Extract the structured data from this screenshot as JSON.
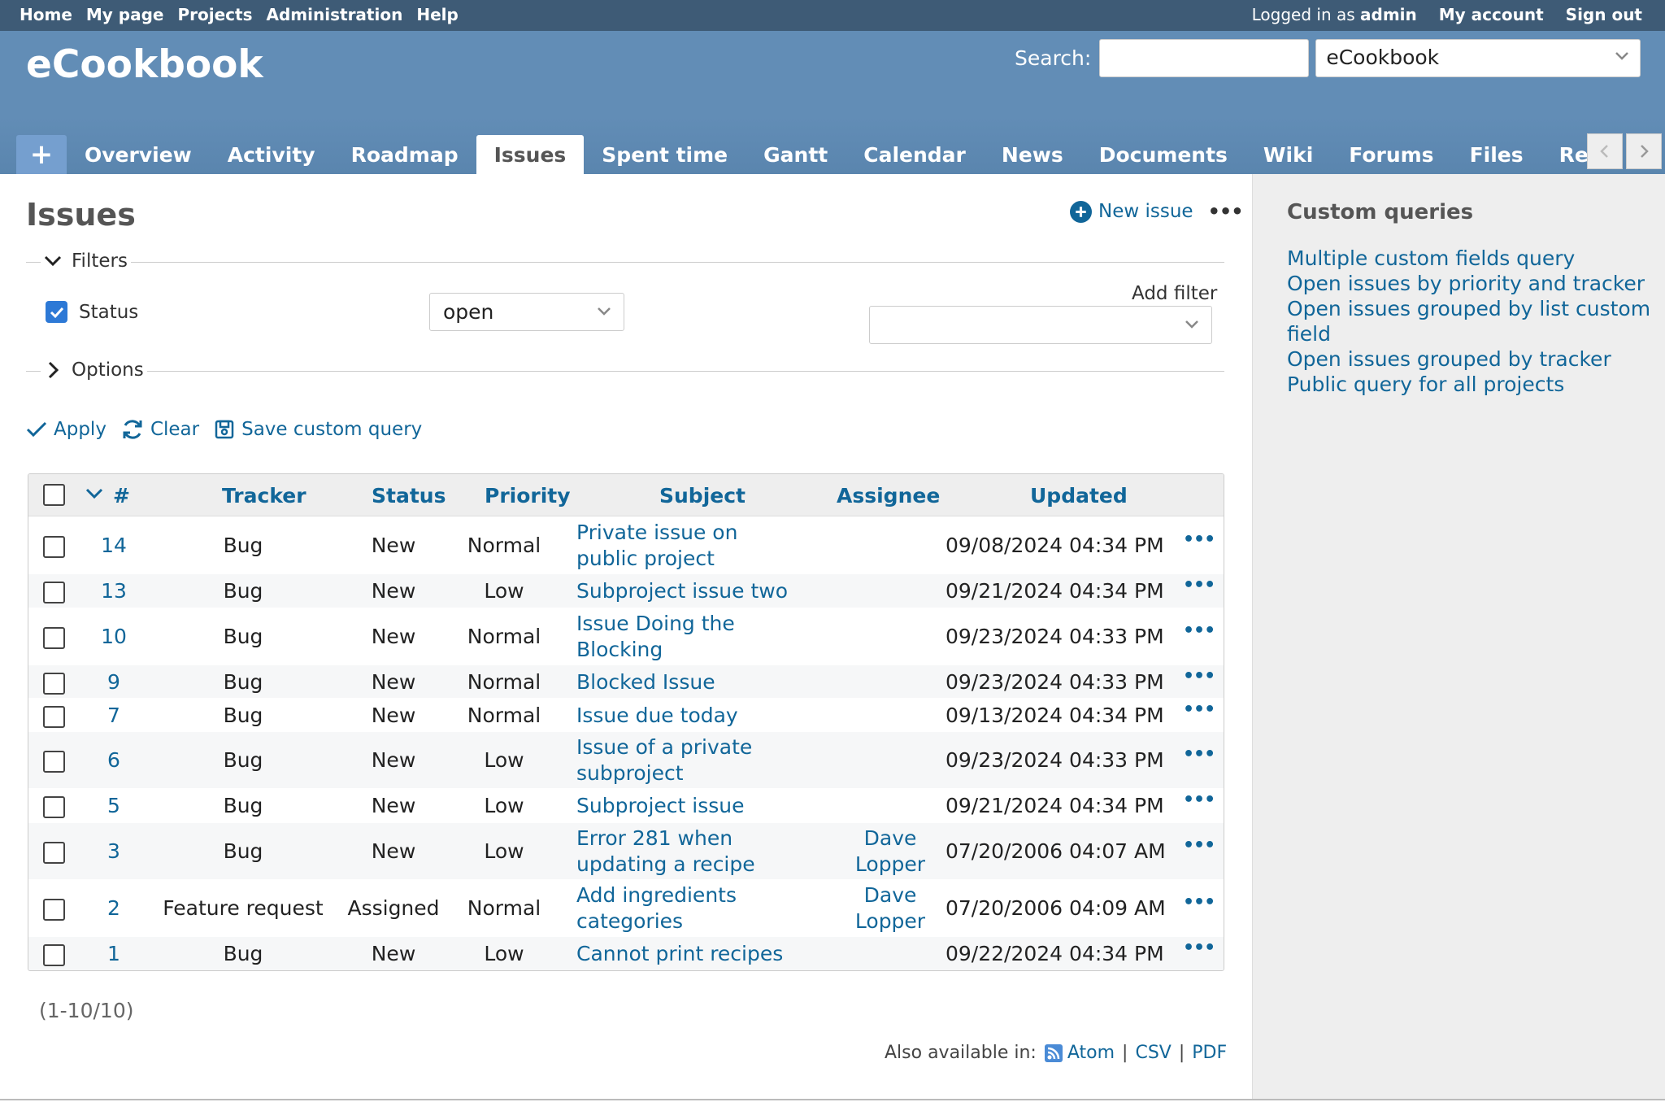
{
  "top_menu": {
    "left": [
      "Home",
      "My page",
      "Projects",
      "Administration",
      "Help"
    ],
    "logged_prefix": "Logged in as",
    "logged_user": "admin",
    "my_account": "My account",
    "sign_out": "Sign out"
  },
  "header": {
    "project_title": "eCookbook",
    "search_label": "Search:",
    "search_value": "",
    "project_select": "eCookbook"
  },
  "main_menu": {
    "plus": "+",
    "tabs": [
      "Overview",
      "Activity",
      "Roadmap",
      "Issues",
      "Spent time",
      "Gantt",
      "Calendar",
      "News",
      "Documents",
      "Wiki",
      "Forums",
      "Files",
      "Repository"
    ],
    "selected": "Issues"
  },
  "content": {
    "title": "Issues",
    "new_issue": "New issue",
    "more": "•••",
    "filters_legend": "Filters",
    "filter_status_label": "Status",
    "filter_status_operator": "open",
    "add_filter_label": "Add filter",
    "options_legend": "Options",
    "apply": "Apply",
    "clear": "Clear",
    "save_query": "Save custom query"
  },
  "table": {
    "headers": {
      "id": "#",
      "tracker": "Tracker",
      "status": "Status",
      "priority": "Priority",
      "subject": "Subject",
      "assignee": "Assignee",
      "updated": "Updated"
    },
    "rows": [
      {
        "id": "14",
        "tracker": "Bug",
        "status": "New",
        "priority": "Normal",
        "subject": "Private issue on public project",
        "subject_l1": "Private issue on",
        "subject_l2": "public project",
        "assignee_l1": "",
        "assignee_l2": "",
        "updated": "09/08/2024 04:34 PM"
      },
      {
        "id": "13",
        "tracker": "Bug",
        "status": "New",
        "priority": "Low",
        "subject_l1": "Subproject issue two",
        "subject_l2": "",
        "assignee_l1": "",
        "assignee_l2": "",
        "updated": "09/21/2024 04:34 PM"
      },
      {
        "id": "10",
        "tracker": "Bug",
        "status": "New",
        "priority": "Normal",
        "subject_l1": "Issue Doing the",
        "subject_l2": "Blocking",
        "assignee_l1": "",
        "assignee_l2": "",
        "updated": "09/23/2024 04:33 PM"
      },
      {
        "id": "9",
        "tracker": "Bug",
        "status": "New",
        "priority": "Normal",
        "subject_l1": "Blocked Issue",
        "subject_l2": "",
        "assignee_l1": "",
        "assignee_l2": "",
        "updated": "09/23/2024 04:33 PM"
      },
      {
        "id": "7",
        "tracker": "Bug",
        "status": "New",
        "priority": "Normal",
        "subject_l1": "Issue due today",
        "subject_l2": "",
        "assignee_l1": "",
        "assignee_l2": "",
        "updated": "09/13/2024 04:34 PM"
      },
      {
        "id": "6",
        "tracker": "Bug",
        "status": "New",
        "priority": "Low",
        "subject_l1": "Issue of a private",
        "subject_l2": "subproject",
        "assignee_l1": "",
        "assignee_l2": "",
        "updated": "09/23/2024 04:33 PM"
      },
      {
        "id": "5",
        "tracker": "Bug",
        "status": "New",
        "priority": "Low",
        "subject_l1": "Subproject issue",
        "subject_l2": "",
        "assignee_l1": "",
        "assignee_l2": "",
        "updated": "09/21/2024 04:34 PM"
      },
      {
        "id": "3",
        "tracker": "Bug",
        "status": "New",
        "priority": "Low",
        "subject_l1": "Error 281 when",
        "subject_l2": "updating a recipe",
        "assignee_l1": "Dave",
        "assignee_l2": "Lopper",
        "updated": "07/20/2006 04:07 AM"
      },
      {
        "id": "2",
        "tracker": "Feature request",
        "status": "Assigned",
        "priority": "Normal",
        "subject_l1": "Add ingredients",
        "subject_l2": "categories",
        "assignee_l1": "Dave",
        "assignee_l2": "Lopper",
        "updated": "07/20/2006 04:09 AM"
      },
      {
        "id": "1",
        "tracker": "Bug",
        "status": "New",
        "priority": "Low",
        "subject_l1": "Cannot print recipes",
        "subject_l2": "",
        "assignee_l1": "",
        "assignee_l2": "",
        "updated": "09/22/2024 04:34 PM"
      }
    ],
    "row_more": "•••"
  },
  "footer": {
    "pagination": "(1-10/10)",
    "also_available": "Also available in:",
    "formats": [
      "Atom",
      "CSV",
      "PDF"
    ],
    "separator": "|"
  },
  "sidebar": {
    "title": "Custom queries",
    "queries": [
      "Multiple custom fields query",
      "Open issues by priority and tracker",
      "Open issues grouped by list custom field",
      "Open issues grouped by tracker",
      "Public query for all projects"
    ]
  },
  "colors": {
    "top_menu": "#3e5b76",
    "header": "#628db6",
    "link": "#116699",
    "checkbox_checked": "#2d79d6"
  }
}
